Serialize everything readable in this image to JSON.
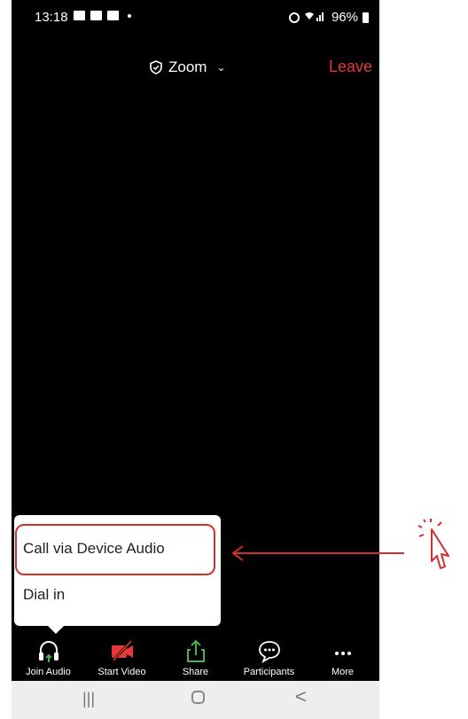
{
  "status_bar": {
    "time": "13:18",
    "battery": "96%"
  },
  "top_bar": {
    "meeting_title": "Zoom",
    "leave_label": "Leave"
  },
  "audio_menu": {
    "items": [
      {
        "label": "Call via Device Audio"
      },
      {
        "label": "Dial in"
      }
    ]
  },
  "toolbar": {
    "items": [
      {
        "label": "Join Audio",
        "icon": "headphones-icon"
      },
      {
        "label": "Start Video",
        "icon": "video-off-icon"
      },
      {
        "label": "Share",
        "icon": "share-icon"
      },
      {
        "label": "Participants",
        "icon": "chat-bubble-icon"
      },
      {
        "label": "More",
        "icon": "more-dots-icon"
      }
    ]
  },
  "nav_bar": {
    "recent": "|||",
    "back": "<"
  },
  "colors": {
    "leave": "#e53935",
    "highlight": "#d32f2f",
    "share_green": "#4caf50",
    "video_red": "#e53935"
  }
}
